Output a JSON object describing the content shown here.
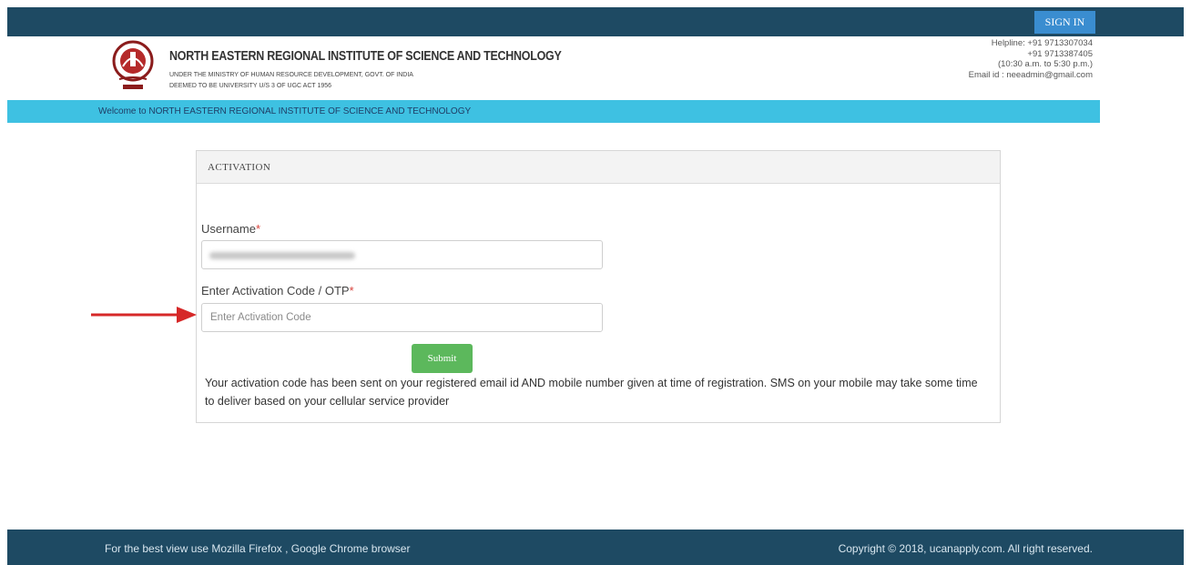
{
  "header": {
    "signin_label": "SIGN IN",
    "institute_name": "NORTH EASTERN REGIONAL INSTITUTE OF SCIENCE AND TECHNOLOGY",
    "sub_line1": "UNDER THE MINISTRY OF HUMAN RESOURCE DEVELOPMENT, GOVT. OF INDIA",
    "sub_line2": "DEEMED TO BE UNIVERSITY U/S 3 OF UGC ACT 1956",
    "contact": {
      "line1": "Helpline: +91 9713307034",
      "line2": "+91 9713387405",
      "line3": "(10:30 a.m. to 5:30 p.m.)",
      "line4": "Email id : neeadmin@gmail.com"
    }
  },
  "welcome_text": "Welcome to NORTH EASTERN REGIONAL INSTITUTE OF SCIENCE AND TECHNOLOGY",
  "form": {
    "title": "ACTIVATION",
    "username_label": "Username",
    "required_mark": "*",
    "code_label": "Enter Activation Code / OTP",
    "code_placeholder": "Enter Activation Code",
    "submit_label": "Submit",
    "notice": "Your activation code has been sent on your registered email id AND mobile number given at time of registration. SMS on your mobile may take some time to deliver based on your cellular service provider"
  },
  "footer": {
    "left": "For the best view use Mozilla Firefox , Google Chrome browser",
    "right": "Copyright © 2018, ucanapply.com. All right reserved."
  },
  "colors": {
    "topbar": "#1e4a63",
    "signin": "#3a8dd0",
    "welcome_bar": "#3ec1e2",
    "submit": "#5cb85c",
    "arrow": "#d62828"
  },
  "icons": {
    "logo": "institute-logo",
    "annotation": "red-arrow-icon"
  }
}
